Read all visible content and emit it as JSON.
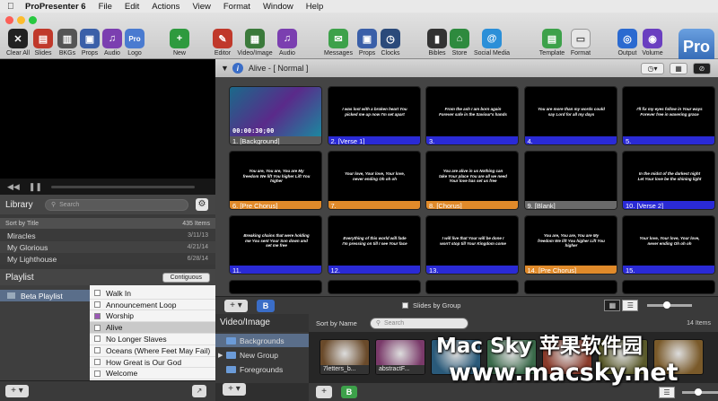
{
  "menubar": {
    "app": "ProPresenter 6",
    "items": [
      "File",
      "Edit",
      "Actions",
      "View",
      "Format",
      "Window",
      "Help"
    ]
  },
  "toolbar": {
    "groups": [
      {
        "label": "Clear All",
        "icon": "clear-icon",
        "color": "#222"
      },
      {
        "label": "Slides",
        "icon": "slides-icon",
        "color": "#c0392b"
      },
      {
        "label": "BKGs",
        "icon": "backgrounds-icon",
        "color": "#555"
      },
      {
        "label": "Props",
        "icon": "props-icon",
        "color": "#3a5fa8"
      },
      {
        "label": "Audio",
        "icon": "audio-icon",
        "color": "#7b3fb0"
      },
      {
        "label": "Logo",
        "icon": "logo-icon",
        "color": "#4a7bd0"
      },
      {
        "label": "New",
        "icon": "new-icon",
        "color": "#2e9a3e"
      },
      {
        "label": "Editor",
        "icon": "editor-icon",
        "color": "#c0392b"
      },
      {
        "label": "Video/Image",
        "icon": "video-image-icon",
        "color": "#3b7a3b"
      },
      {
        "label": "Audio",
        "icon": "audio-icon",
        "color": "#7b3fb0"
      },
      {
        "label": "Messages",
        "icon": "messages-icon",
        "color": "#3da14a"
      },
      {
        "label": "Props",
        "icon": "props-icon",
        "color": "#3a5fa8"
      },
      {
        "label": "Clocks",
        "icon": "clocks-icon",
        "color": "#2b4a7a"
      },
      {
        "label": "Bibles",
        "icon": "bibles-icon",
        "color": "#333"
      },
      {
        "label": "Store",
        "icon": "store-icon",
        "color": "#2e8a3e"
      },
      {
        "label": "Social Media",
        "icon": "social-media-icon",
        "color": "#2b8fd8"
      },
      {
        "label": "Template",
        "icon": "template-icon",
        "color": "#3da14a"
      },
      {
        "label": "Format",
        "icon": "format-icon",
        "color": "#e6e6e6"
      },
      {
        "label": "Output",
        "icon": "output-icon",
        "color": "#2b6ad0"
      },
      {
        "label": "Volume",
        "icon": "volume-icon",
        "color": "#6a3fc0"
      }
    ],
    "logo_text": "Pro"
  },
  "library": {
    "title": "Library",
    "search_placeholder": "Search",
    "sort_label": "Sort by Title",
    "count": "435 Items",
    "items": [
      {
        "title": "Miracles",
        "date": "3/11/13"
      },
      {
        "title": "My Glorious",
        "date": "4/21/14"
      },
      {
        "title": "My Lighthouse",
        "date": "6/28/14"
      }
    ]
  },
  "playlist": {
    "title": "Playlist",
    "mode_button": "Contiguous",
    "name": "Beta Playlist",
    "items": [
      "Walk In",
      "Announcement Loop",
      "Worship",
      "Alive",
      "No Longer Slaves",
      "Oceans (Where Feet May Fail)",
      "How Great is Our God",
      "Welcome"
    ]
  },
  "presentation": {
    "title": "Alive - [ Normal ]",
    "slides": [
      {
        "label": "1. [Background]",
        "text": "",
        "color": "#5a5a5a",
        "timer": "00:00:30;00"
      },
      {
        "label": "2. [Verse 1]",
        "text": "I was lost with a broken heart You picked me up now I'm set apart",
        "color": "#2a2ad6"
      },
      {
        "label": "3.",
        "text": "From the ash I am born again Forever safe in the Saviour's hands",
        "color": "#2a2ad6"
      },
      {
        "label": "4.",
        "text": "You are more than my words could say Lord for all my days",
        "color": "#2a2ad6"
      },
      {
        "label": "5.",
        "text": "I'll fix my eyes follow in Your ways Forever free in wavering grace",
        "color": "#2a2ad6"
      },
      {
        "label": "6. [Pre Chorus]",
        "text": "You are, You are, You are My freedom We lift You higher Lift You higher",
        "color": "#e08a2a"
      },
      {
        "label": "7.",
        "text": "Your love, Your love, Your love, never ending Oh oh oh",
        "color": "#e08a2a"
      },
      {
        "label": "8. [Chorus]",
        "text": "You are alive in us Nothing can take Your place You are all we need Your love has set us free",
        "color": "#e08a2a"
      },
      {
        "label": "9. [Blank]",
        "text": "",
        "color": "#6a6a6a"
      },
      {
        "label": "10. [Verse 2]",
        "text": "In the midst of the darkest night Let Your love be the shining light",
        "color": "#2a2ad6"
      },
      {
        "label": "11.",
        "text": "Breaking chains that were holding me You sent Your Son down and set me free",
        "color": "#2a2ad6"
      },
      {
        "label": "12.",
        "text": "Everything of this world will fade I'm pressing on till I see Your face",
        "color": "#2a2ad6"
      },
      {
        "label": "13.",
        "text": "I will live that Your will be done I won't stop till Your Kingdom come",
        "color": "#2a2ad6"
      },
      {
        "label": "14. [Pre Chorus]",
        "text": "You are, You are, You are My freedom We lift You higher Lift You higher",
        "color": "#e08a2a"
      },
      {
        "label": "15.",
        "text": "Your love, Your love, Your love, never ending Oh oh oh",
        "color": "#2a2ad6"
      }
    ],
    "group_toggle": "Slides by Group"
  },
  "video_image": {
    "title": "Video/Image",
    "sort_label": "Sort by Name",
    "search_placeholder": "Search",
    "count": "14 Items",
    "folders": [
      "Backgrounds",
      "New Group",
      "Foregrounds"
    ],
    "media": [
      {
        "label": "7letters_b...",
        "color": "#6a4a2a"
      },
      {
        "label": "abstractF...",
        "color": "#7a3a6a"
      },
      {
        "label": "",
        "color": "#2a5a7a"
      },
      {
        "label": "",
        "color": "#3a6a4a"
      },
      {
        "label": "",
        "color": "#8a3a2a"
      },
      {
        "label": "",
        "color": "#5a5a2a"
      },
      {
        "label": "",
        "color": "#7a5a2a"
      }
    ]
  },
  "watermark": {
    "line1": "Mac Sky 苹果软件园",
    "line2": "www.macsky.net"
  }
}
